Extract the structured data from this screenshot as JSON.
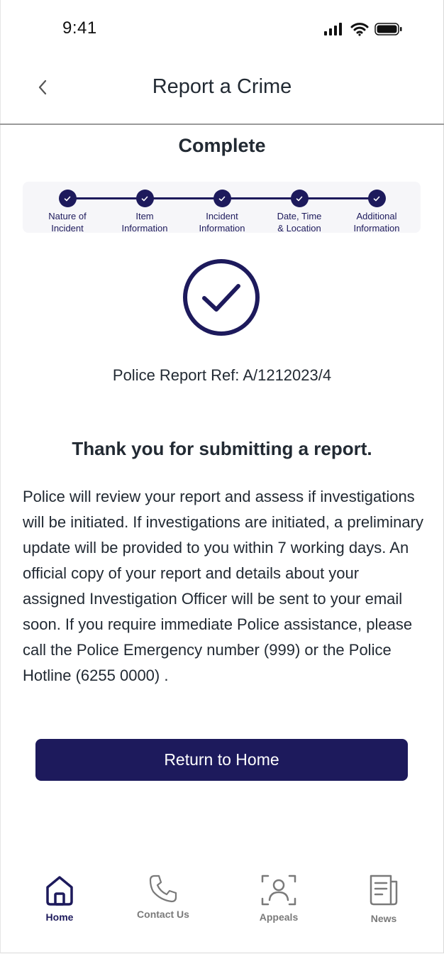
{
  "status_bar": {
    "time": "9:41"
  },
  "header": {
    "title": "Report a Crime",
    "back_icon": "chevron-left-icon"
  },
  "step_title": "Complete",
  "stepper": {
    "steps": [
      {
        "label": "Nature of\nIncident"
      },
      {
        "label": "Item\nInformation"
      },
      {
        "label": "Incident\nInformation"
      },
      {
        "label": "Date, Time\n& Location"
      },
      {
        "label": "Additional\nInformation"
      }
    ]
  },
  "confirmation": {
    "reference": "Police Report Ref: A/1212023/4",
    "heading": "Thank you for submitting a report.",
    "message": "Police will review your report and assess if investigations will be initiated. If investigations are initiated, a preliminary update will be provided to you within 7 working days. An official copy of your report and details about your assigned Investigation Officer will be sent to your email soon. If you require immediate Police assistance, please call the Police Emergency number (999) or the Police Hotline (6255 0000) ."
  },
  "actions": {
    "return_home": "Return to Home"
  },
  "tab_bar": {
    "items": [
      {
        "label": "Home",
        "icon": "home-icon",
        "active": true
      },
      {
        "label": "Contact Us",
        "icon": "phone-icon",
        "active": false
      },
      {
        "label": "Appeals",
        "icon": "person-scan-icon",
        "active": false
      },
      {
        "label": "News",
        "icon": "newspaper-icon",
        "active": false
      }
    ]
  },
  "colors": {
    "primary": "#1d1a5c",
    "text": "#222a33",
    "inactive": "#7a7a7a"
  }
}
